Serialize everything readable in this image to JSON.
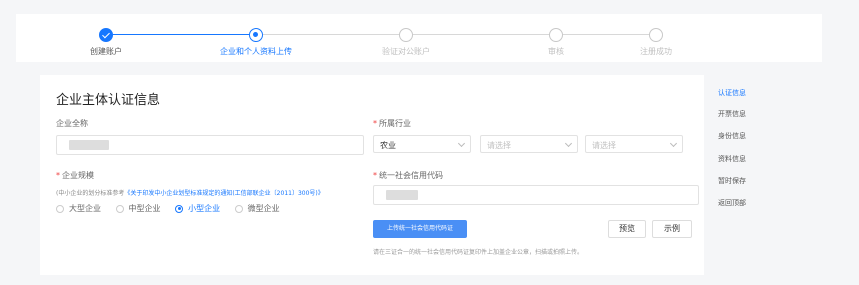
{
  "steps": [
    {
      "label": "创建账户",
      "state": "done"
    },
    {
      "label": "企业和个人资料上传",
      "state": "active"
    },
    {
      "label": "验证对公账户",
      "state": "todo"
    },
    {
      "label": "审核",
      "state": "todo"
    },
    {
      "label": "注册成功",
      "state": "todo"
    }
  ],
  "form": {
    "title": "企业主体认证信息",
    "company_name_label": "企业全称",
    "industry_label": "所属行业",
    "industry_value": "农业",
    "select_placeholder": "请选择",
    "scale_label": "企业规模",
    "scale_note_prefix": "(中小企业的划分标准参考",
    "scale_note_link": "《关于印发中小企业划型标准规定的通知(工信部联企业〔2011〕300号)》",
    "scale_options": [
      "大型企业",
      "中型企业",
      "小型企业",
      "微型企业"
    ],
    "scale_selected": "小型企业",
    "credit_code_label": "统一社会信用代码",
    "upload_button": "上传统一社会信用代码证",
    "preview_button": "预览",
    "example_button": "示例",
    "upload_help": "请在三证合一的统一社会信用代码证复印件上加盖企业公章，扫描或拍照上传。"
  },
  "side_nav": [
    "认证信息",
    "开票信息",
    "身份信息",
    "资料信息",
    "暂时保存",
    "返回顶部"
  ],
  "side_nav_active": "认证信息",
  "colors": {
    "accent": "#1677ff",
    "required": "#f04040"
  }
}
